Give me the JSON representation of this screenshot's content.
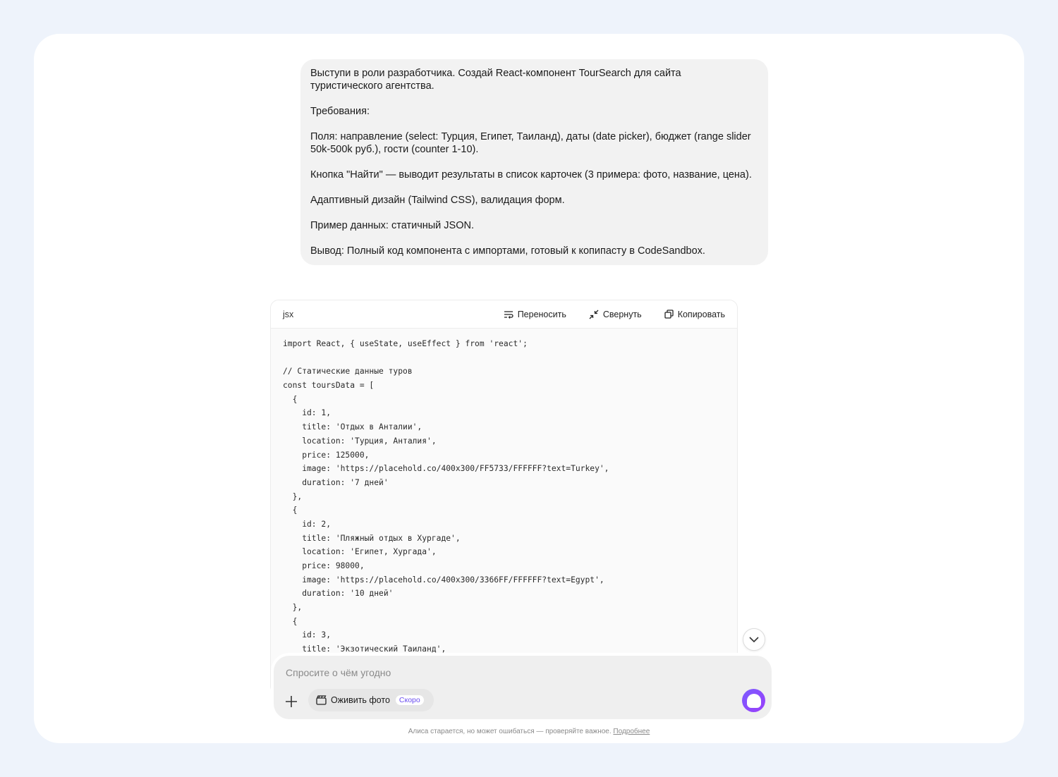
{
  "user_message": {
    "paragraphs": [
      "Выступи в роли разработчика. Создай React-компонент TourSearch для сайта туристического агентства.",
      "Требования:",
      "Поля: направление (select: Турция, Египет, Таиланд), даты (date picker), бюджет (range slider 50k-500k руб.), гости (counter 1-10).",
      "Кнопка \"Найти\" — выводит результаты в список карточек (3 примера: фото, название, цена).",
      "Адаптивный дизайн (Tailwind CSS), валидация форм.",
      "Пример данных: статичный JSON.",
      "Вывод: Полный код компонента с импортами, готовый к копипасту в CodeSandbox."
    ]
  },
  "code_block": {
    "language": "jsx",
    "actions": {
      "wrap": "Переносить",
      "collapse": "Свернуть",
      "copy": "Копировать"
    },
    "lines": [
      "import React, { useState, useEffect } from 'react';",
      "",
      "// Статические данные туров",
      "const toursData = [",
      "  {",
      "    id: 1,",
      "    title: 'Отдых в Анталии',",
      "    location: 'Турция, Анталия',",
      "    price: 125000,",
      "    image: 'https://placehold.co/400x300/FF5733/FFFFFF?text=Turkey',",
      "    duration: '7 дней'",
      "  },",
      "  {",
      "    id: 2,",
      "    title: 'Пляжный отдых в Хургаде',",
      "    location: 'Египет, Хургада',",
      "    price: 98000,",
      "    image: 'https://placehold.co/400x300/3366FF/FFFFFF?text=Egypt',",
      "    duration: '10 дней'",
      "  },",
      "  {",
      "    id: 3,",
      "    title: 'Экзотический Таиланд',"
    ]
  },
  "composer": {
    "placeholder": "Спросите о чём угодно",
    "photo_chip_label": "Оживить фото",
    "photo_chip_badge": "Скоро"
  },
  "footer": {
    "disclaimer": "Алиса старается, но может ошибаться — проверяйте важное.",
    "more_link": "Подробнее"
  }
}
